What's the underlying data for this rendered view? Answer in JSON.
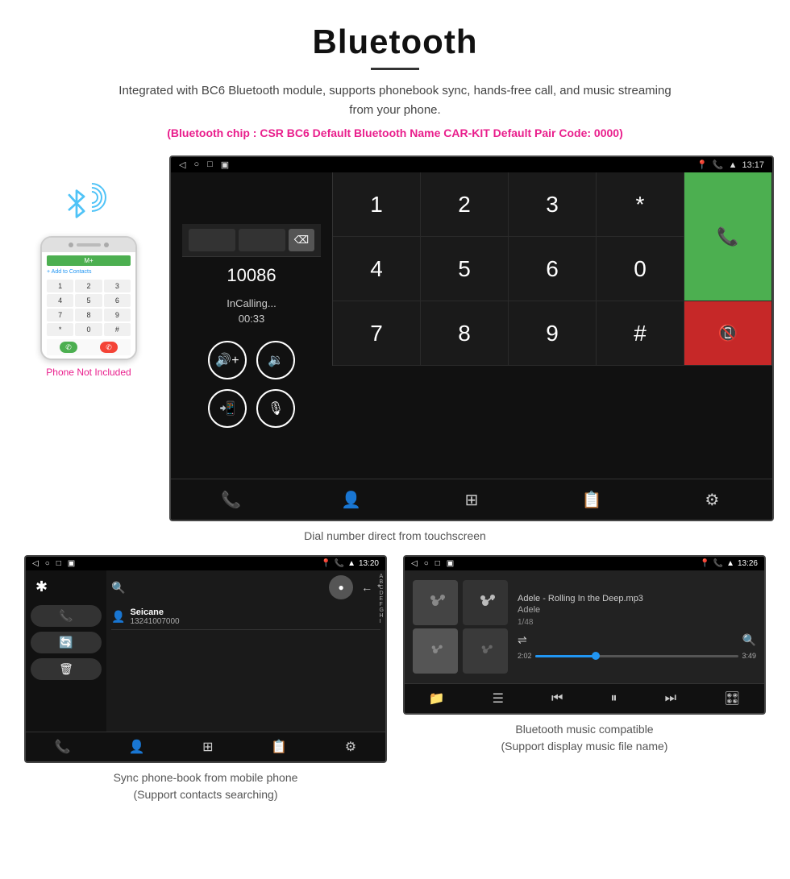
{
  "header": {
    "title": "Bluetooth",
    "description": "Integrated with BC6 Bluetooth module, supports phonebook sync, hands-free call, and music streaming from your phone.",
    "specs": "(Bluetooth chip : CSR BC6    Default Bluetooth Name CAR-KIT    Default Pair Code: 0000)"
  },
  "phone_aside": {
    "not_included": "Phone Not Included"
  },
  "car_screen": {
    "status_bar": {
      "nav_back": "◁",
      "nav_home": "○",
      "nav_recent": "□",
      "nav_cast": "▣",
      "time": "13:17",
      "location": "♦",
      "phone": "✆",
      "signal": "▲"
    },
    "dialer": {
      "number": "10086",
      "status": "InCalling...",
      "timer": "00:33"
    },
    "numpad": {
      "keys": [
        "1",
        "2",
        "3",
        "*",
        "4",
        "5",
        "6",
        "0",
        "7",
        "8",
        "9",
        "#"
      ]
    }
  },
  "dial_caption": "Dial number direct from touchscreen",
  "phonebook_screen": {
    "time": "13:20",
    "contact_name": "Seicane",
    "contact_number": "13241007000",
    "alphabet": [
      "A",
      "B",
      "C",
      "D",
      "E",
      "F",
      "G",
      "H",
      "I"
    ]
  },
  "phonebook_caption": "Sync phone-book from mobile phone\n(Support contacts searching)",
  "music_screen": {
    "time": "13:26",
    "song_name": "Adele - Rolling In the Deep.mp3",
    "artist": "Adele",
    "track_count": "1/48",
    "time_current": "2:02",
    "time_total": "3:49",
    "progress_percent": 30
  },
  "music_caption": "Bluetooth music compatible\n(Support display music file name)"
}
